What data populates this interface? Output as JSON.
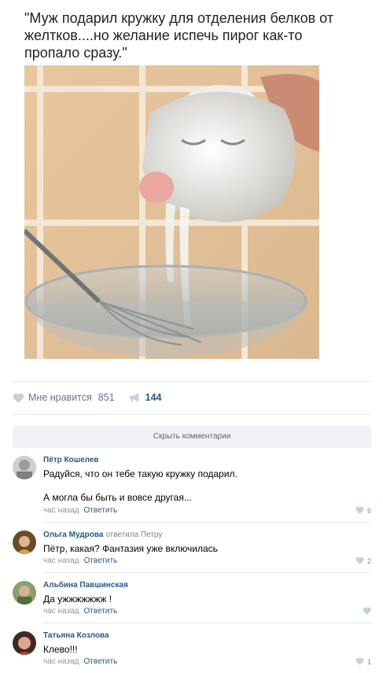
{
  "post": {
    "text": "\"Муж подарил кружку для отделения белков от желтков....но желание испечь пирог как-то пропало сразу.\""
  },
  "actions": {
    "like_label": "Мне нравится",
    "like_count": "851",
    "share_count": "144"
  },
  "hide_comments_label": "Скрыть комментарии",
  "comments": [
    {
      "author": "Пётр Кошелев",
      "replied_to": "",
      "text_line1": "Радуйся, что он тебе такую кружку подарил.",
      "text_line2": "А могла бы быть и вовсе другая...",
      "time": "час назад",
      "reply_label": "Ответить",
      "likes": "6"
    },
    {
      "author": "Ольга Мудрова",
      "replied_to": "ответила Петру",
      "text_line1": "Пётр, какая? Фантазия уже включилась",
      "time": "час назад",
      "reply_label": "Ответить",
      "likes": "2"
    },
    {
      "author": "Альбина Павшинская",
      "replied_to": "",
      "text_line1": "Да ужжжжжжж !",
      "time": "час назад",
      "reply_label": "Ответить",
      "likes": ""
    },
    {
      "author": "Татьяна Козлова",
      "replied_to": "",
      "text_line1": "Клево!!!",
      "time": "час назад",
      "reply_label": "Ответить",
      "likes": "1"
    }
  ],
  "colors": {
    "link": "#2a5885",
    "meta": "#939393",
    "like_icon": "#c5d0db",
    "hide_bg": "#f0f2f5"
  },
  "icons": [
    "heart-icon",
    "share-icon"
  ]
}
